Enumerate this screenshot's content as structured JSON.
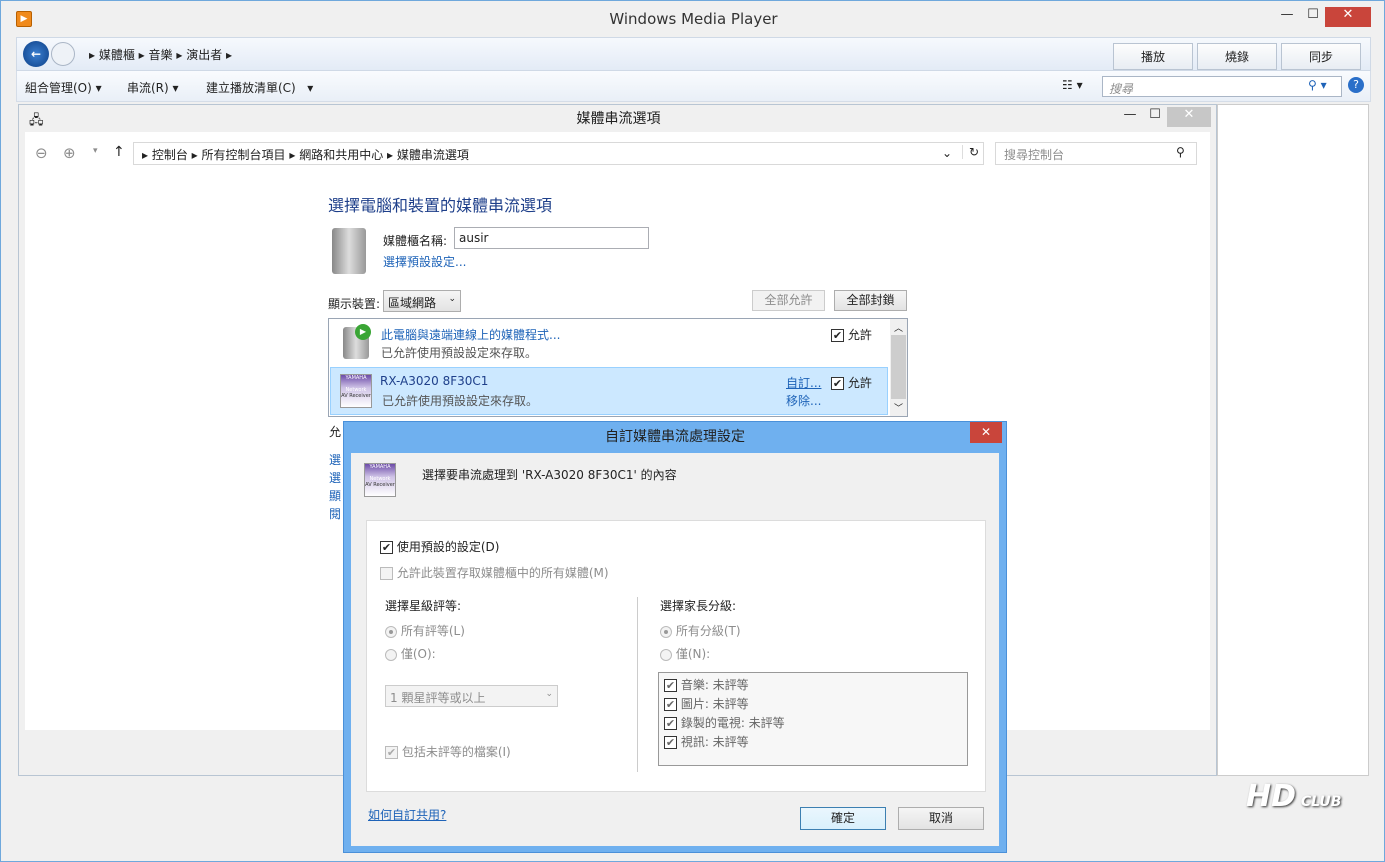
{
  "wmp": {
    "title": "Windows Media Player",
    "breadcrumb": [
      "媒體櫃",
      "音樂",
      "演出者"
    ],
    "tabs": [
      "播放",
      "燒錄",
      "同步"
    ],
    "toolbar": [
      "組合管理(O)",
      "串流(R)",
      "建立播放清單(C)"
    ],
    "search_placeholder": "搜尋"
  },
  "cp": {
    "title": "媒體串流選項",
    "address": [
      "控制台",
      "所有控制台項目",
      "網路和共用中心",
      "媒體串流選項"
    ],
    "search_placeholder": "搜尋控制台",
    "heading": "選擇電腦和裝置的媒體串流選項",
    "library_name_label": "媒體櫃名稱:",
    "library_name": "ausir",
    "choose_defaults": "選擇預設設定...",
    "show_devices_label": "顯示裝置:",
    "show_devices_value": "區域網路",
    "allow_all": "全部允許",
    "block_all": "全部封鎖",
    "devices": [
      {
        "name": "此電腦與遠端連線上的媒體程式...",
        "status": "已允許使用預設設定來存取。",
        "allow": "允許"
      },
      {
        "name": "RX-A3020 8F30C1",
        "status": "已允許使用預設設定來存取。",
        "customize": "自訂...",
        "remove": "移除...",
        "allow": "允許"
      }
    ],
    "partial_links": [
      "允",
      "選",
      "選",
      "顯",
      "閱"
    ]
  },
  "dialog": {
    "title": "自訂媒體串流處理設定",
    "subtitle": "選擇要串流處理到 'RX-A3020 8F30C1' 的內容",
    "use_defaults": "使用預設的設定(D)",
    "allow_all_media": "允許此裝置存取媒體櫃中的所有媒體(M)",
    "star_heading": "選擇星級評等:",
    "star_all": "所有評等(L)",
    "star_only": "僅(O):",
    "star_select": "1 顆星評等或以上",
    "include_unrated": "包括未評等的檔案(I)",
    "parental_heading": "選擇家長分級:",
    "parental_all": "所有分級(T)",
    "parental_only": "僅(N):",
    "parental_items": [
      "音樂: 未評等",
      "圖片: 未評等",
      "錄製的電視: 未評等",
      "視訊: 未評等"
    ],
    "help_link": "如何自訂共用?",
    "ok": "確定",
    "cancel": "取消",
    "icon_text": "YAMAHA Network AV Receiver"
  },
  "watermark": "HD Club"
}
